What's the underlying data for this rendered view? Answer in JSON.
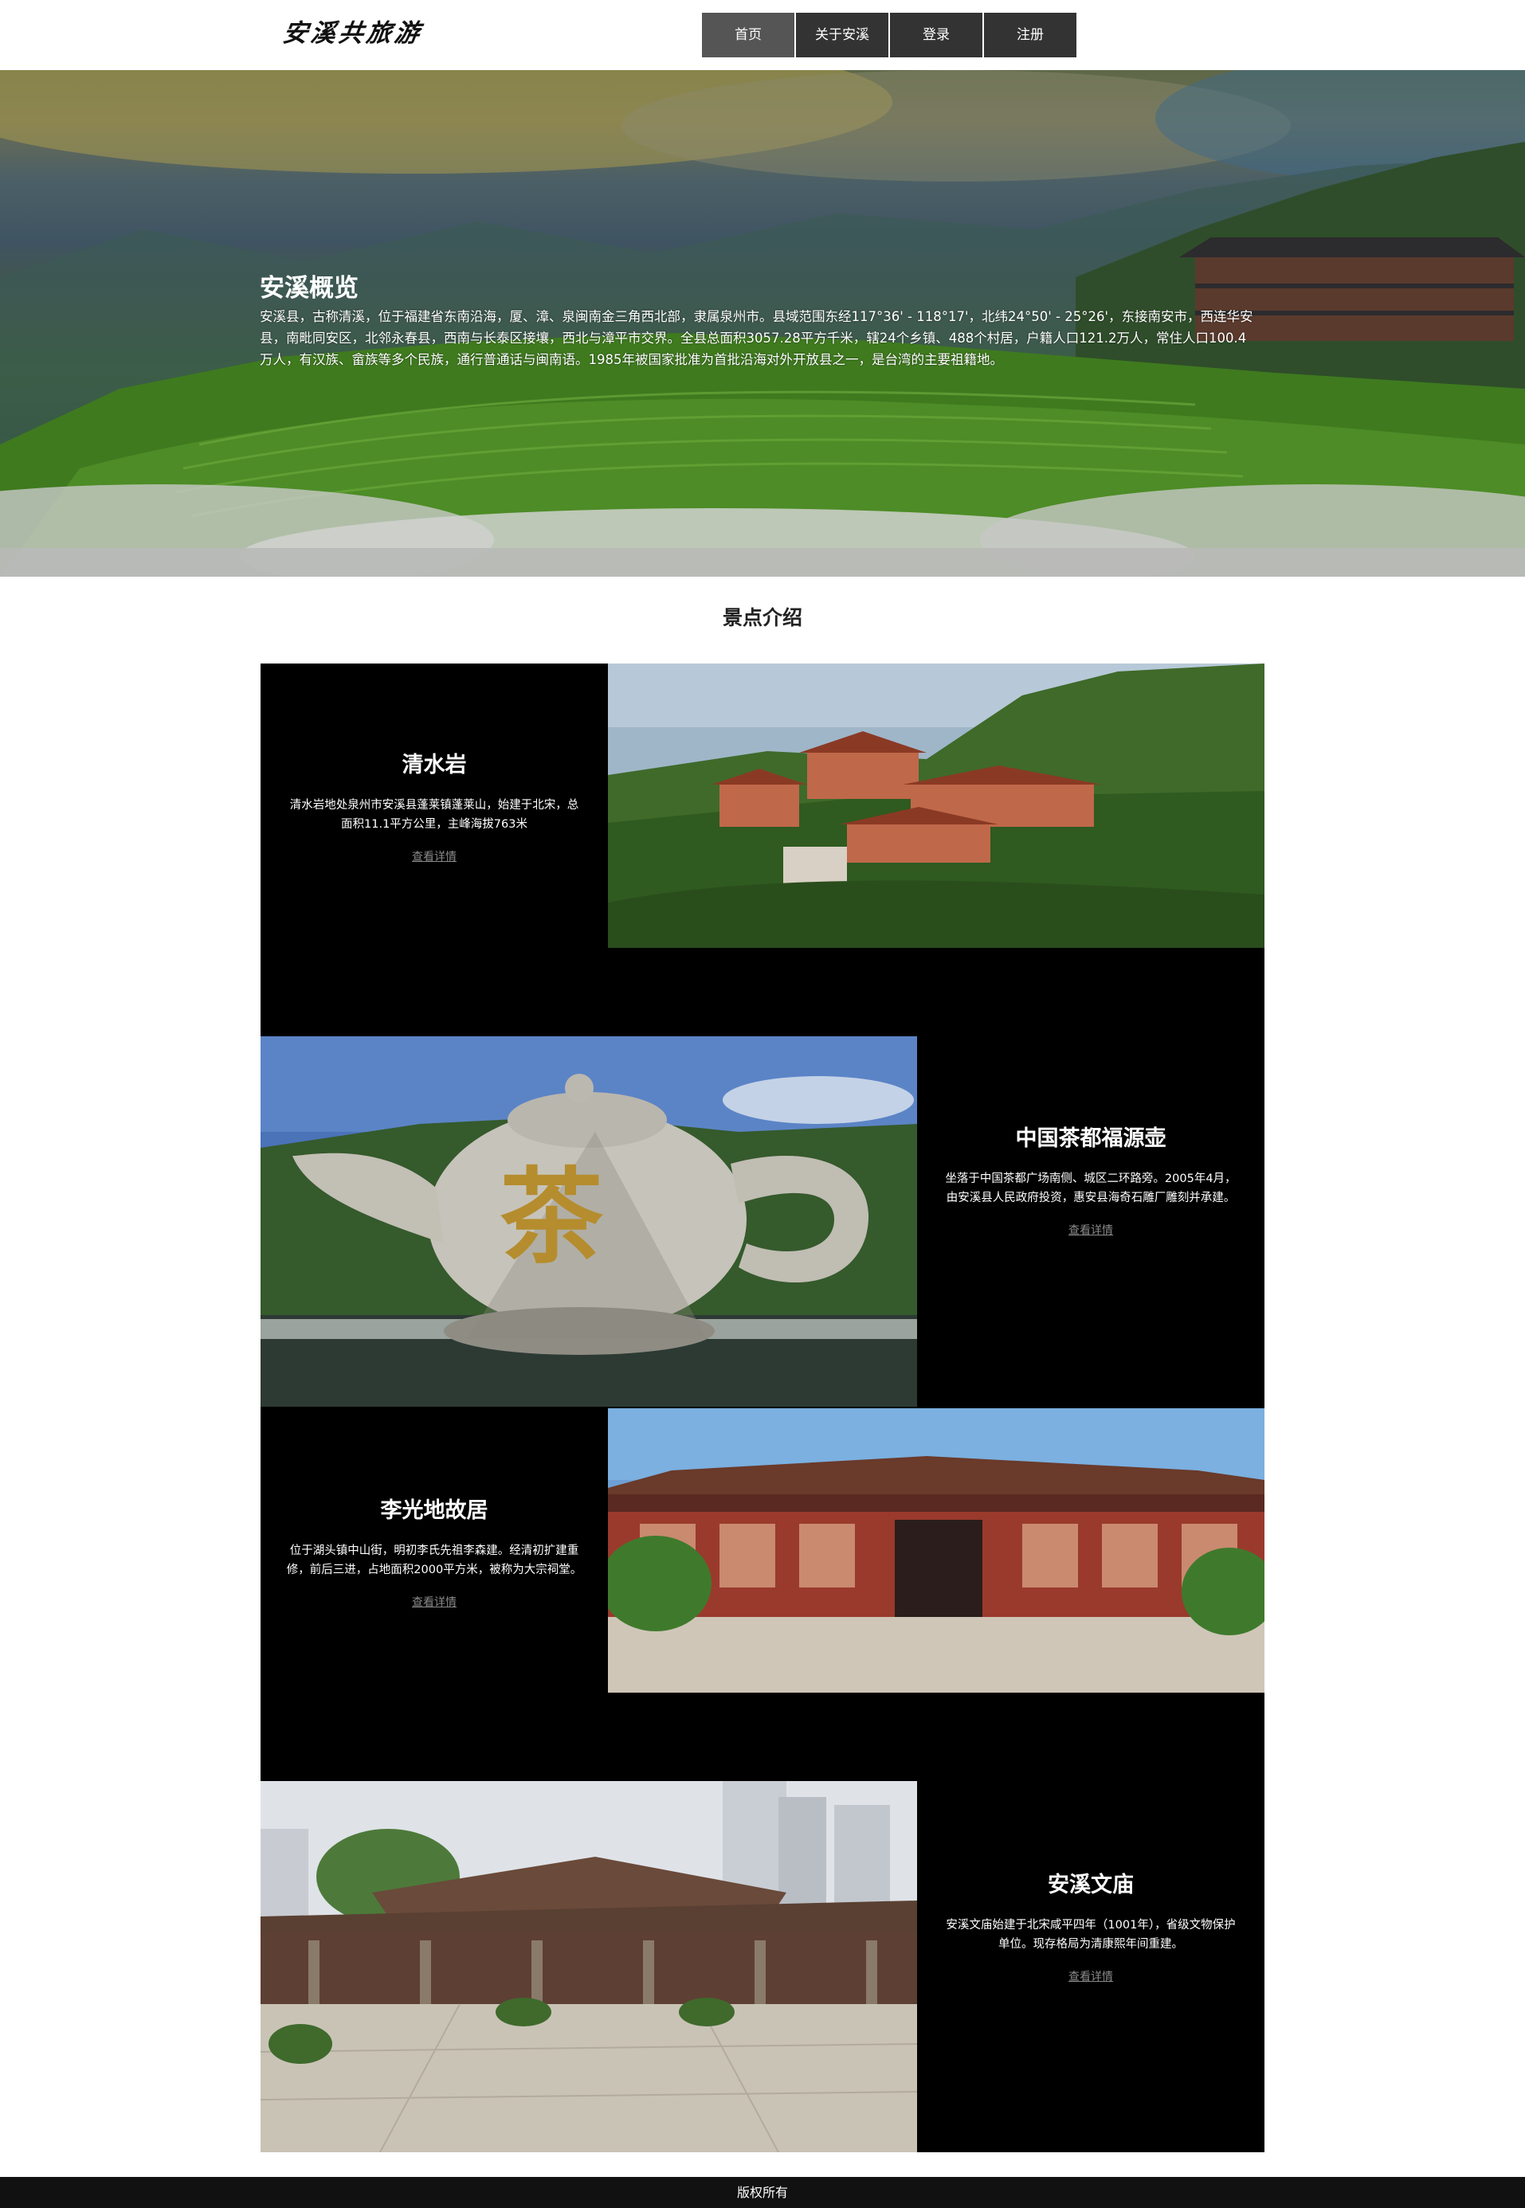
{
  "header": {
    "logo_text": "安溪共旅游",
    "nav": [
      {
        "label": "首页",
        "active": true
      },
      {
        "label": "关于安溪",
        "active": false
      },
      {
        "label": "登录",
        "active": false
      },
      {
        "label": "注册",
        "active": false
      }
    ]
  },
  "hero": {
    "title": "安溪概览",
    "text": "安溪县，古称清溪，位于福建省东南沿海，厦、漳、泉闽南金三角西北部，隶属泉州市。县域范围东经117°36' - 118°17'，北纬24°50' - 25°26'，东接南安市，西连华安县，南毗同安区，北邻永春县，西南与长泰区接壤，西北与漳平市交界。全县总面积3057.28平方千米，辖24个乡镇、488个村居，户籍人口121.2万人，常住人口100.4万人，有汉族、畲族等多个民族，通行普通话与闽南语。1985年被国家批准为首批沿海对外开放县之一，是台湾的主要祖籍地。"
  },
  "section": {
    "title": "景点介绍"
  },
  "spots": [
    {
      "name": "清水岩",
      "desc": "清水岩地处泉州市安溪县蓬莱镇蓬莱山，始建于北宋，总面积11.1平方公里，主峰海拔763米",
      "link": "查看详情"
    },
    {
      "name": "中国茶都福源壶",
      "desc": "坐落于中国茶都广场南侧、城区二环路旁。2005年4月，由安溪县人民政府投资，惠安县海奇石雕厂雕刻并承建。",
      "link": "查看详情",
      "image_text": "茶"
    },
    {
      "name": "李光地故居",
      "desc": "位于湖头镇中山街，明初李氏先祖李森建。经清初扩建重修，前后三进，占地面积2000平方米，被称为大宗祠堂。",
      "link": "查看详情"
    },
    {
      "name": "安溪文庙",
      "desc": "安溪文庙始建于北宋咸平四年（1001年），省级文物保护单位。现存格局为清康熙年间重建。",
      "link": "查看详情"
    }
  ],
  "footer": {
    "text": "版权所有"
  }
}
